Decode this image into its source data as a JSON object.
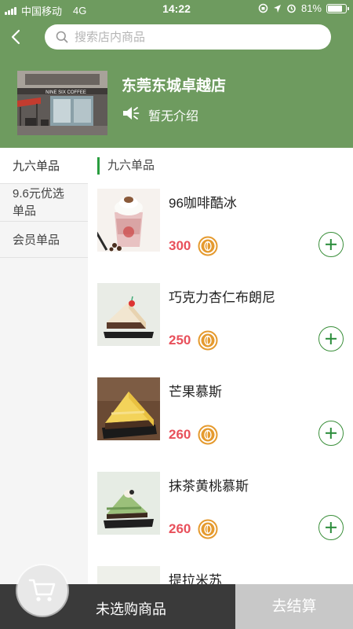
{
  "status_bar": {
    "carrier": "中国移动",
    "network": "4G",
    "time": "14:22",
    "battery": "81%",
    "battery_level": 0.81
  },
  "search": {
    "placeholder": "搜索店内商品"
  },
  "store": {
    "name": "东莞东城卓越店",
    "description": "暂无介绍",
    "sign_text": "NINE SIX COFFEE"
  },
  "sidebar": {
    "items": [
      {
        "label": "九六单品",
        "active": true
      },
      {
        "label": "9.6元优选单品",
        "active": false
      },
      {
        "label": "会员单品",
        "active": false
      }
    ]
  },
  "main": {
    "category_title": "九六单品",
    "products": [
      {
        "name": "96咖啡酷冰",
        "price": "300"
      },
      {
        "name": "巧克力杏仁布朗尼",
        "price": "250"
      },
      {
        "name": "芒果慕斯",
        "price": "260"
      },
      {
        "name": "抹茶黄桃慕斯",
        "price": "260"
      },
      {
        "name": "提拉米苏",
        "price": ""
      }
    ]
  },
  "bottom_bar": {
    "cart_status": "未选购商品",
    "checkout_label": "去结算"
  },
  "colors": {
    "header_bg": "#6e9b5f",
    "accent_green": "#2a9d3f",
    "price_red": "#e8505b",
    "coin_orange": "#e59a2e",
    "bottom_dark": "#3a3a3a",
    "checkout_disabled": "#c8c8c8"
  }
}
